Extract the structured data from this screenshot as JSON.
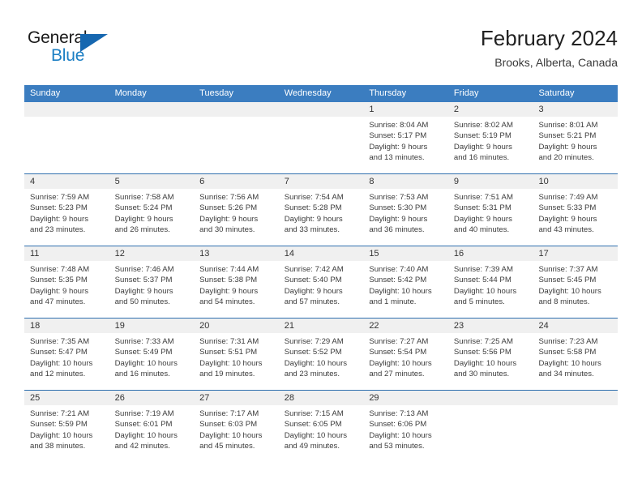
{
  "logo": {
    "word_one": "General",
    "word_two": "Blue",
    "triangle_color": "#1667b0",
    "blue_text_color": "#1c7fc4"
  },
  "header": {
    "title": "February 2024",
    "subtitle": "Brooks, Alberta, Canada"
  },
  "theme": {
    "header_blue": "#3b7dc0",
    "row_rule_blue": "#2f6fae",
    "day_band_gray": "#f0f0f0"
  },
  "weekdays": [
    "Sunday",
    "Monday",
    "Tuesday",
    "Wednesday",
    "Thursday",
    "Friday",
    "Saturday"
  ],
  "weeks": [
    [
      {
        "day": "",
        "lines": []
      },
      {
        "day": "",
        "lines": []
      },
      {
        "day": "",
        "lines": []
      },
      {
        "day": "",
        "lines": []
      },
      {
        "day": "1",
        "lines": [
          "Sunrise: 8:04 AM",
          "Sunset: 5:17 PM",
          "Daylight: 9 hours",
          "and 13 minutes."
        ]
      },
      {
        "day": "2",
        "lines": [
          "Sunrise: 8:02 AM",
          "Sunset: 5:19 PM",
          "Daylight: 9 hours",
          "and 16 minutes."
        ]
      },
      {
        "day": "3",
        "lines": [
          "Sunrise: 8:01 AM",
          "Sunset: 5:21 PM",
          "Daylight: 9 hours",
          "and 20 minutes."
        ]
      }
    ],
    [
      {
        "day": "4",
        "lines": [
          "Sunrise: 7:59 AM",
          "Sunset: 5:23 PM",
          "Daylight: 9 hours",
          "and 23 minutes."
        ]
      },
      {
        "day": "5",
        "lines": [
          "Sunrise: 7:58 AM",
          "Sunset: 5:24 PM",
          "Daylight: 9 hours",
          "and 26 minutes."
        ]
      },
      {
        "day": "6",
        "lines": [
          "Sunrise: 7:56 AM",
          "Sunset: 5:26 PM",
          "Daylight: 9 hours",
          "and 30 minutes."
        ]
      },
      {
        "day": "7",
        "lines": [
          "Sunrise: 7:54 AM",
          "Sunset: 5:28 PM",
          "Daylight: 9 hours",
          "and 33 minutes."
        ]
      },
      {
        "day": "8",
        "lines": [
          "Sunrise: 7:53 AM",
          "Sunset: 5:30 PM",
          "Daylight: 9 hours",
          "and 36 minutes."
        ]
      },
      {
        "day": "9",
        "lines": [
          "Sunrise: 7:51 AM",
          "Sunset: 5:31 PM",
          "Daylight: 9 hours",
          "and 40 minutes."
        ]
      },
      {
        "day": "10",
        "lines": [
          "Sunrise: 7:49 AM",
          "Sunset: 5:33 PM",
          "Daylight: 9 hours",
          "and 43 minutes."
        ]
      }
    ],
    [
      {
        "day": "11",
        "lines": [
          "Sunrise: 7:48 AM",
          "Sunset: 5:35 PM",
          "Daylight: 9 hours",
          "and 47 minutes."
        ]
      },
      {
        "day": "12",
        "lines": [
          "Sunrise: 7:46 AM",
          "Sunset: 5:37 PM",
          "Daylight: 9 hours",
          "and 50 minutes."
        ]
      },
      {
        "day": "13",
        "lines": [
          "Sunrise: 7:44 AM",
          "Sunset: 5:38 PM",
          "Daylight: 9 hours",
          "and 54 minutes."
        ]
      },
      {
        "day": "14",
        "lines": [
          "Sunrise: 7:42 AM",
          "Sunset: 5:40 PM",
          "Daylight: 9 hours",
          "and 57 minutes."
        ]
      },
      {
        "day": "15",
        "lines": [
          "Sunrise: 7:40 AM",
          "Sunset: 5:42 PM",
          "Daylight: 10 hours",
          "and 1 minute."
        ]
      },
      {
        "day": "16",
        "lines": [
          "Sunrise: 7:39 AM",
          "Sunset: 5:44 PM",
          "Daylight: 10 hours",
          "and 5 minutes."
        ]
      },
      {
        "day": "17",
        "lines": [
          "Sunrise: 7:37 AM",
          "Sunset: 5:45 PM",
          "Daylight: 10 hours",
          "and 8 minutes."
        ]
      }
    ],
    [
      {
        "day": "18",
        "lines": [
          "Sunrise: 7:35 AM",
          "Sunset: 5:47 PM",
          "Daylight: 10 hours",
          "and 12 minutes."
        ]
      },
      {
        "day": "19",
        "lines": [
          "Sunrise: 7:33 AM",
          "Sunset: 5:49 PM",
          "Daylight: 10 hours",
          "and 16 minutes."
        ]
      },
      {
        "day": "20",
        "lines": [
          "Sunrise: 7:31 AM",
          "Sunset: 5:51 PM",
          "Daylight: 10 hours",
          "and 19 minutes."
        ]
      },
      {
        "day": "21",
        "lines": [
          "Sunrise: 7:29 AM",
          "Sunset: 5:52 PM",
          "Daylight: 10 hours",
          "and 23 minutes."
        ]
      },
      {
        "day": "22",
        "lines": [
          "Sunrise: 7:27 AM",
          "Sunset: 5:54 PM",
          "Daylight: 10 hours",
          "and 27 minutes."
        ]
      },
      {
        "day": "23",
        "lines": [
          "Sunrise: 7:25 AM",
          "Sunset: 5:56 PM",
          "Daylight: 10 hours",
          "and 30 minutes."
        ]
      },
      {
        "day": "24",
        "lines": [
          "Sunrise: 7:23 AM",
          "Sunset: 5:58 PM",
          "Daylight: 10 hours",
          "and 34 minutes."
        ]
      }
    ],
    [
      {
        "day": "25",
        "lines": [
          "Sunrise: 7:21 AM",
          "Sunset: 5:59 PM",
          "Daylight: 10 hours",
          "and 38 minutes."
        ]
      },
      {
        "day": "26",
        "lines": [
          "Sunrise: 7:19 AM",
          "Sunset: 6:01 PM",
          "Daylight: 10 hours",
          "and 42 minutes."
        ]
      },
      {
        "day": "27",
        "lines": [
          "Sunrise: 7:17 AM",
          "Sunset: 6:03 PM",
          "Daylight: 10 hours",
          "and 45 minutes."
        ]
      },
      {
        "day": "28",
        "lines": [
          "Sunrise: 7:15 AM",
          "Sunset: 6:05 PM",
          "Daylight: 10 hours",
          "and 49 minutes."
        ]
      },
      {
        "day": "29",
        "lines": [
          "Sunrise: 7:13 AM",
          "Sunset: 6:06 PM",
          "Daylight: 10 hours",
          "and 53 minutes."
        ]
      },
      {
        "day": "",
        "lines": []
      },
      {
        "day": "",
        "lines": []
      }
    ]
  ]
}
